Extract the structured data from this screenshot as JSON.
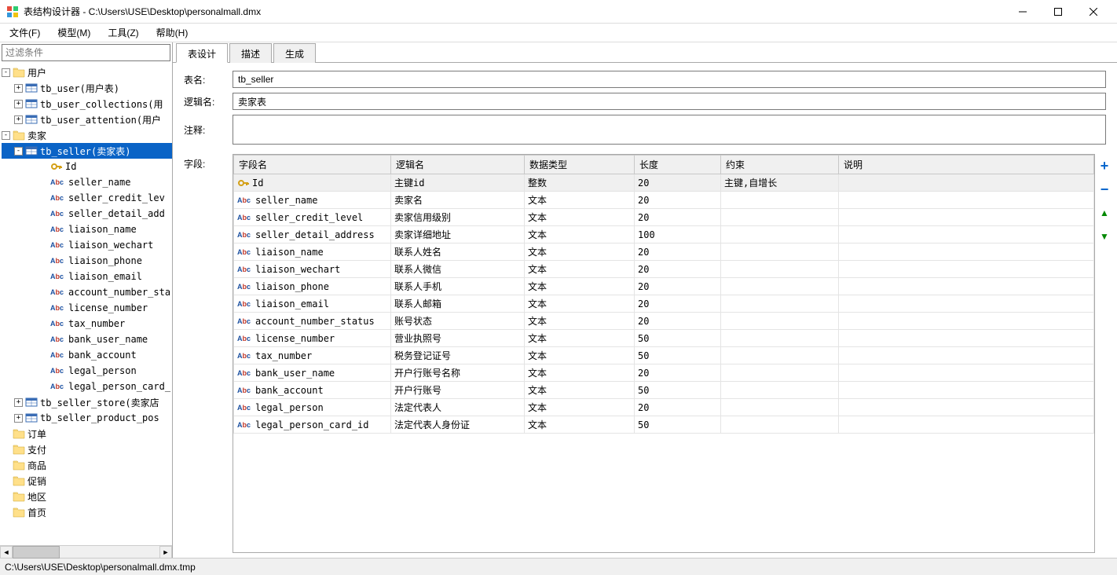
{
  "window": {
    "title": "表结构设计器 - C:\\Users\\USE\\Desktop\\personalmall.dmx"
  },
  "menu": {
    "file": "文件(F)",
    "model": "模型(M)",
    "tools": "工具(Z)",
    "help": "帮助(H)"
  },
  "sidebar": {
    "filter_placeholder": "过滤条件",
    "tree": {
      "user_group": "用户",
      "tb_user": "tb_user(用户表)",
      "tb_user_collections": "tb_user_collections(用",
      "tb_user_attention": "tb_user_attention(用户",
      "seller_group": "卖家",
      "tb_seller": "tb_seller(卖家表)",
      "fields": {
        "id": "Id",
        "seller_name": "seller_name",
        "seller_credit_level": "seller_credit_lev",
        "seller_detail_address": "seller_detail_add",
        "liaison_name": "liaison_name",
        "liaison_wechart": "liaison_wechart",
        "liaison_phone": "liaison_phone",
        "liaison_email": "liaison_email",
        "account_number_status": "account_number_sta",
        "license_number": "license_number",
        "tax_number": "tax_number",
        "bank_user_name": "bank_user_name",
        "bank_account": "bank_account",
        "legal_person": "legal_person",
        "legal_person_card_id": "legal_person_card_"
      },
      "tb_seller_store": "tb_seller_store(卖家店",
      "tb_seller_product_pos": "tb_seller_product_pos",
      "order_group": "订单",
      "pay_group": "支付",
      "goods_group": "商品",
      "promo_group": "促销",
      "region_group": "地区",
      "home_group": "首页"
    }
  },
  "tabs": {
    "design": "表设计",
    "desc": "描述",
    "gen": "生成"
  },
  "form": {
    "table_name_label": "表名:",
    "table_name_value": "tb_seller",
    "logic_name_label": "逻辑名:",
    "logic_name_value": "卖家表",
    "comment_label": "注释:",
    "comment_value": "",
    "fields_label": "字段:"
  },
  "grid": {
    "headers": {
      "field_name": "字段名",
      "logic_name": "逻辑名",
      "data_type": "数据类型",
      "length": "长度",
      "constraint": "约束",
      "desc": "说明"
    },
    "rows": [
      {
        "icon": "key",
        "name": "Id",
        "logic": "主键id",
        "type": "整数",
        "len": "20",
        "constraint": "主键,自增长",
        "desc": ""
      },
      {
        "icon": "abc",
        "name": "seller_name",
        "logic": "卖家名",
        "type": "文本",
        "len": "20",
        "constraint": "",
        "desc": ""
      },
      {
        "icon": "abc",
        "name": "seller_credit_level",
        "logic": "卖家信用级别",
        "type": "文本",
        "len": "20",
        "constraint": "",
        "desc": ""
      },
      {
        "icon": "abc",
        "name": "seller_detail_address",
        "logic": "卖家详细地址",
        "type": "文本",
        "len": "100",
        "constraint": "",
        "desc": ""
      },
      {
        "icon": "abc",
        "name": "liaison_name",
        "logic": "联系人姓名",
        "type": "文本",
        "len": "20",
        "constraint": "",
        "desc": ""
      },
      {
        "icon": "abc",
        "name": "liaison_wechart",
        "logic": "联系人微信",
        "type": "文本",
        "len": "20",
        "constraint": "",
        "desc": ""
      },
      {
        "icon": "abc",
        "name": "liaison_phone",
        "logic": "联系人手机",
        "type": "文本",
        "len": "20",
        "constraint": "",
        "desc": ""
      },
      {
        "icon": "abc",
        "name": "liaison_email",
        "logic": "联系人邮箱",
        "type": "文本",
        "len": "20",
        "constraint": "",
        "desc": ""
      },
      {
        "icon": "abc",
        "name": "account_number_status",
        "logic": "账号状态",
        "type": "文本",
        "len": "20",
        "constraint": "",
        "desc": ""
      },
      {
        "icon": "abc",
        "name": "license_number",
        "logic": "营业执照号",
        "type": "文本",
        "len": "50",
        "constraint": "",
        "desc": ""
      },
      {
        "icon": "abc",
        "name": "tax_number",
        "logic": "税务登记证号",
        "type": "文本",
        "len": "50",
        "constraint": "",
        "desc": ""
      },
      {
        "icon": "abc",
        "name": "bank_user_name",
        "logic": "开户行账号名称",
        "type": "文本",
        "len": "20",
        "constraint": "",
        "desc": ""
      },
      {
        "icon": "abc",
        "name": "bank_account",
        "logic": "开户行账号",
        "type": "文本",
        "len": "50",
        "constraint": "",
        "desc": ""
      },
      {
        "icon": "abc",
        "name": "legal_person",
        "logic": "法定代表人",
        "type": "文本",
        "len": "20",
        "constraint": "",
        "desc": ""
      },
      {
        "icon": "abc",
        "name": "legal_person_card_id",
        "logic": "法定代表人身份证",
        "type": "文本",
        "len": "50",
        "constraint": "",
        "desc": ""
      }
    ]
  },
  "status": {
    "path": "C:\\Users\\USE\\Desktop\\personalmall.dmx.tmp"
  }
}
